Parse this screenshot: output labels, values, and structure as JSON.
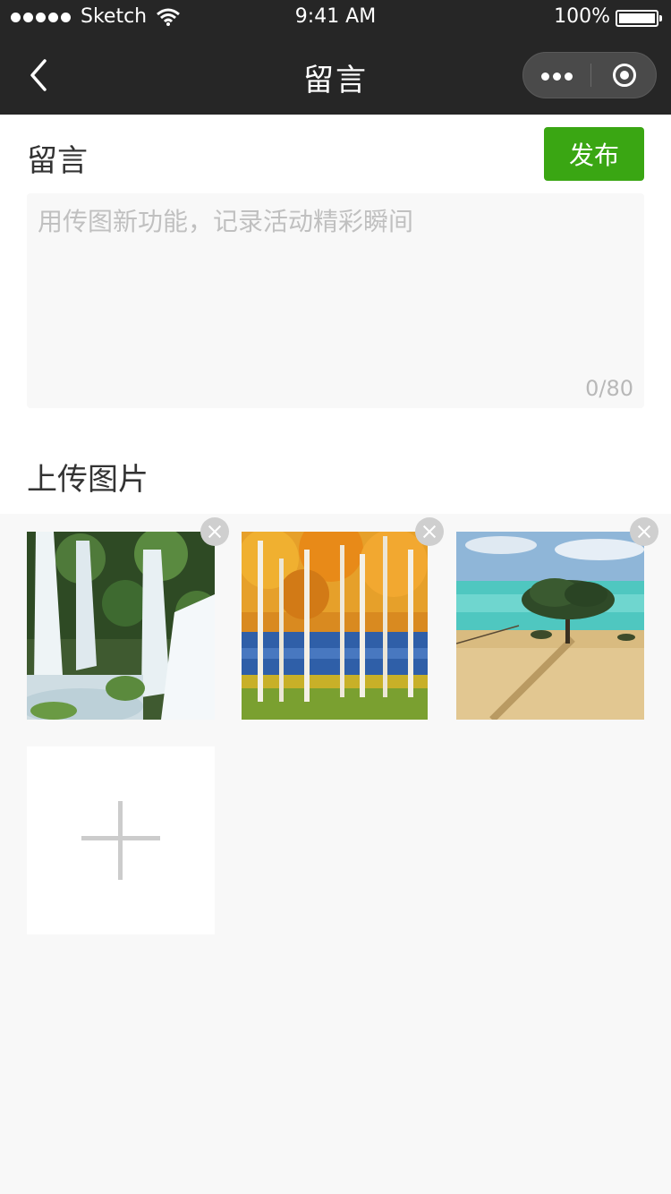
{
  "status_bar": {
    "carrier": "Sketch",
    "time": "9:41 AM",
    "battery": "100%",
    "icons": [
      "signal-dots-icon",
      "wifi-icon",
      "battery-icon"
    ]
  },
  "navbar": {
    "title": "留言",
    "back_icon": "chevron-left-icon",
    "capsule_icons": [
      "more-dots-icon",
      "close-target-icon"
    ]
  },
  "message": {
    "label": "留言",
    "publish_label": "发布",
    "placeholder": "用传图新功能，记录活动精彩瞬间",
    "value": "",
    "counter": "0/80"
  },
  "upload": {
    "label": "上传图片",
    "images": [
      {
        "subject": "waterfall"
      },
      {
        "subject": "autumn-birch-forest"
      },
      {
        "subject": "tree-on-grassland"
      }
    ],
    "delete_icon": "close-circle-icon",
    "add_icon": "plus-icon"
  },
  "colors": {
    "topbar": "#262626",
    "accent_green": "#3aa613",
    "page_bg": "#f8f8f8"
  }
}
